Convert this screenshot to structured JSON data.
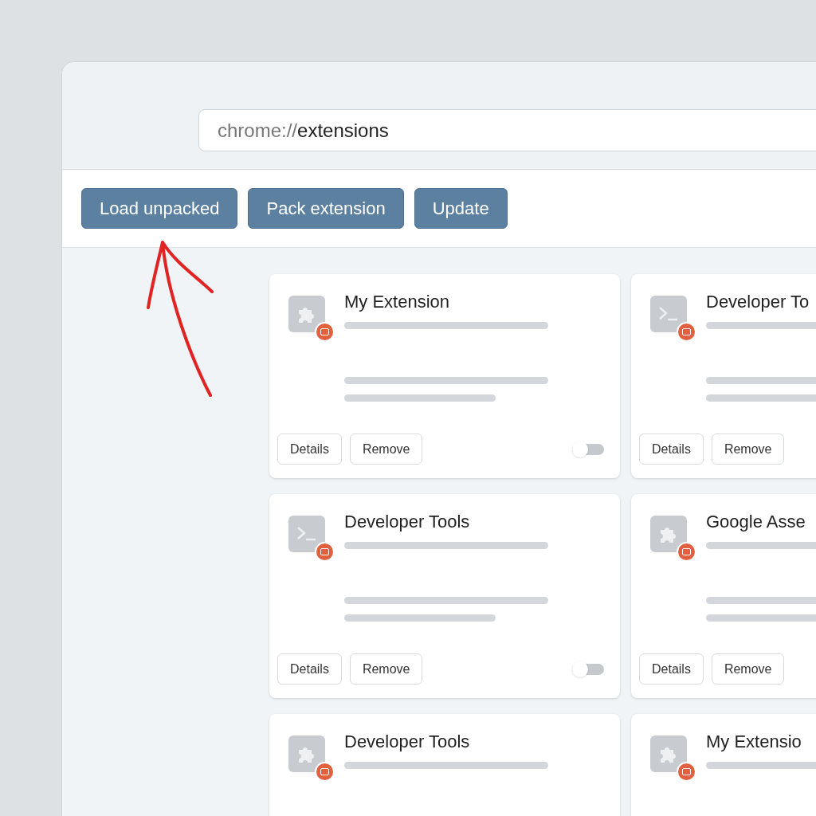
{
  "address_bar": {
    "scheme": "chrome://",
    "path": "extensions"
  },
  "toolbar": {
    "buttons": [
      "Load unpacked",
      "Pack extension",
      "Update"
    ]
  },
  "cards": [
    {
      "title": "My Extension",
      "kind": "puzzle",
      "buttons": [
        "Details",
        "Remove"
      ],
      "toggle": {
        "on": false
      }
    },
    {
      "title": "Developer To",
      "kind": "terminal",
      "buttons": [
        "Details",
        "Remove"
      ]
    },
    {
      "title": "Developer Tools",
      "kind": "terminal",
      "buttons": [
        "Details",
        "Remove"
      ],
      "toggle": {
        "on": false
      }
    },
    {
      "title": "Google Asse",
      "kind": "puzzle",
      "buttons": [
        "Details",
        "Remove"
      ]
    },
    {
      "title": "Developer Tools",
      "kind": "puzzle"
    },
    {
      "title": "My Extensio",
      "kind": "puzzle"
    }
  ]
}
